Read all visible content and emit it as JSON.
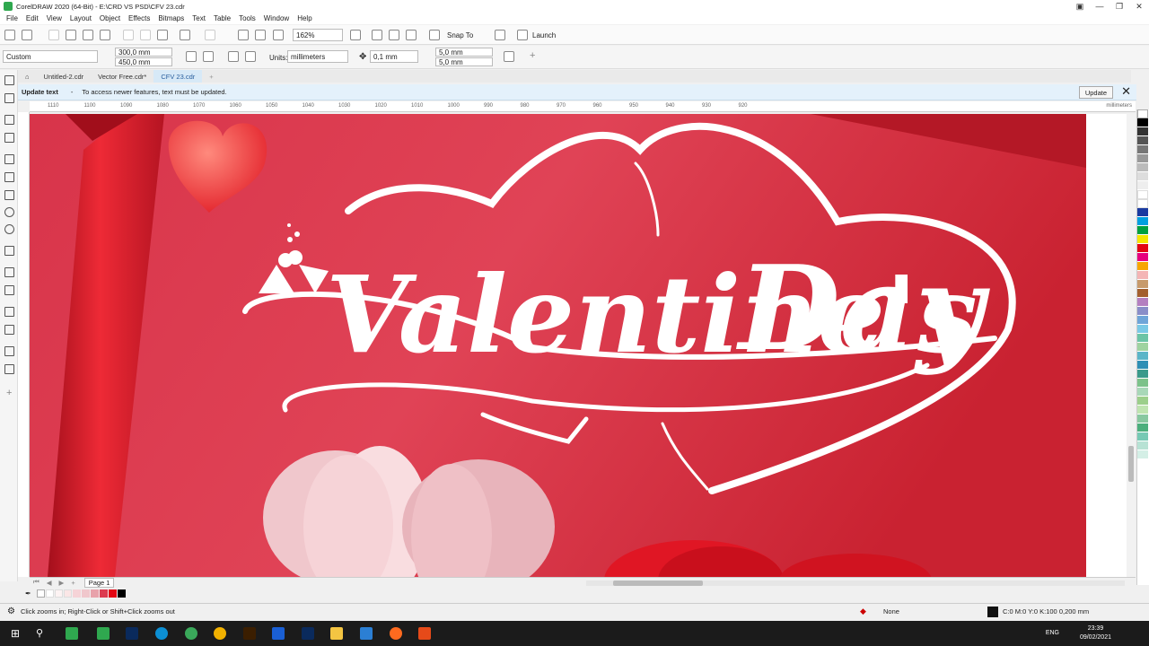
{
  "window": {
    "title": "CorelDRAW 2020 (64-Bit) - E:\\CRD VS PSD\\CFV 23.cdr"
  },
  "menu": [
    "File",
    "Edit",
    "View",
    "Layout",
    "Object",
    "Effects",
    "Bitmaps",
    "Text",
    "Table",
    "Tools",
    "Window",
    "Help"
  ],
  "toolbar": {
    "zoom": "162%",
    "snap_to": "Snap To",
    "launch": "Launch"
  },
  "propertybar": {
    "preset": "Custom",
    "width": "300,0 mm",
    "height": "450,0 mm",
    "units_label": "Units:",
    "units": "millimeters",
    "nudge": "0,1 mm",
    "dup_x": "5,0 mm",
    "dup_y": "5,0 mm"
  },
  "tabs": [
    "Untitled-2.cdr",
    "Vector Free.cdr*",
    "CFV 23.cdr"
  ],
  "notice": {
    "title": "Update text",
    "message": "To access newer features, text must be updated.",
    "button": "Update"
  },
  "ruler": {
    "ticks": [
      "1110",
      "1100",
      "1090",
      "1080",
      "1070",
      "1060",
      "1050",
      "1040",
      "1030",
      "1020",
      "1010",
      "1000",
      "990",
      "980",
      "970",
      "960",
      "950",
      "940",
      "930",
      "920"
    ],
    "unit": "millimeters"
  },
  "artwork": {
    "line1": "Valentine's",
    "line2": "Day"
  },
  "page": {
    "label": "Page 1"
  },
  "status": {
    "hint": "Click zooms in; Right-Click or Shift+Click zooms out",
    "fill": "None",
    "outline": "C:0 M:0 Y:0 K:100  0,200 mm"
  },
  "taskbar": {
    "time": "23:39",
    "date": "09/02/2021",
    "lang": "ENG"
  },
  "colors": {
    "canvas": "#dc3b50",
    "accent": "#d7e9f7"
  }
}
